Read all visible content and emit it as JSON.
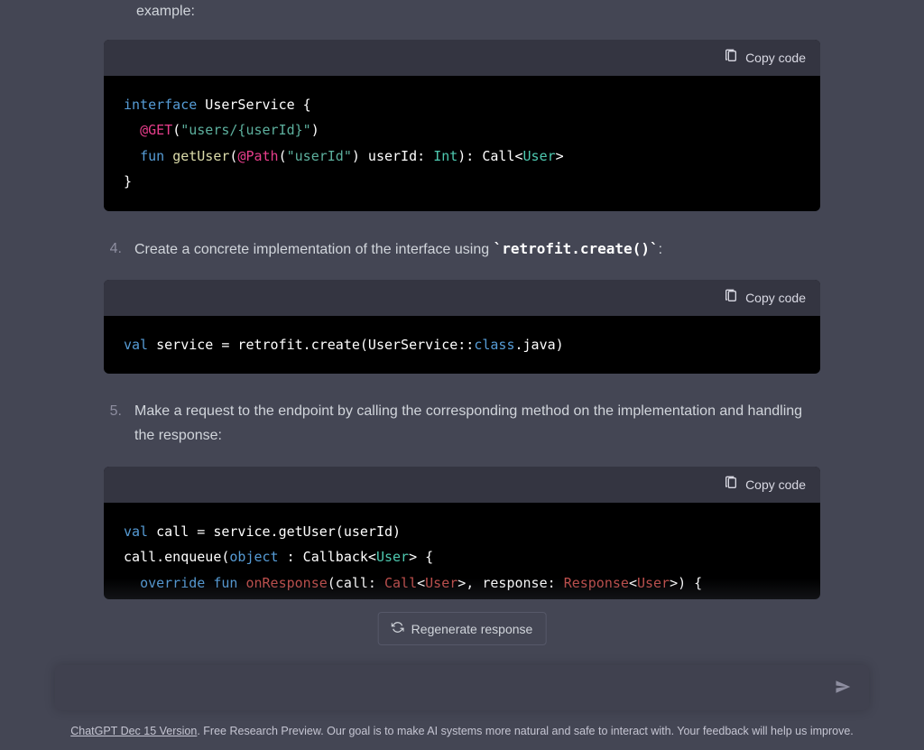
{
  "intro_text": "example:",
  "copy_label": "Copy code",
  "code1": {
    "l1a": "interface",
    "l1b": " UserService {",
    "l2a": "@GET",
    "l2b": "(",
    "l2c": "\"users/{userId}\"",
    "l2d": ")",
    "l3a": "fun",
    "l3b": " ",
    "l3c": "getUser",
    "l3d": "(",
    "l3e": "@Path",
    "l3f": "(",
    "l3g": "\"userId\"",
    "l3h": ") userId: ",
    "l3i": "Int",
    "l3j": "): Call<",
    "l3k": "User",
    "l3l": ">",
    "l4": "}"
  },
  "step4": {
    "num": "4.",
    "text_a": "Create a concrete implementation of the interface using ",
    "code": "`retrofit.create()`",
    "text_b": ":"
  },
  "code2": {
    "a": "val",
    "b": " service = retrofit.create(UserService::",
    "c": "class",
    "d": ".java)"
  },
  "step5": {
    "num": "5.",
    "text": "Make a request to the endpoint by calling the corresponding method on the implementation and handling the response:"
  },
  "code3": {
    "l1a": "val",
    "l1b": " call = service.getUser(userId)",
    "l2a": "call.enqueue(",
    "l2b": "object",
    "l2c": " : Callback<",
    "l2d": "User",
    "l2e": "> {",
    "l3a": "override",
    "l3b": " ",
    "l3c": "fun",
    "l3d": " ",
    "l3e": "onResponse",
    "l3f": "(call: ",
    "l3g": "Call",
    "l3h": "<",
    "l3i": "User",
    "l3j": ">, response: ",
    "l3k": "Response",
    "l3l": "<",
    "l3m": "User",
    "l3n": ">) {"
  },
  "regenerate_label": "Regenerate response",
  "input_placeholder": "",
  "footer": {
    "link": "ChatGPT Dec 15 Version",
    "text": ". Free Research Preview. Our goal is to make AI systems more natural and safe to interact with. Your feedback will help us improve."
  }
}
